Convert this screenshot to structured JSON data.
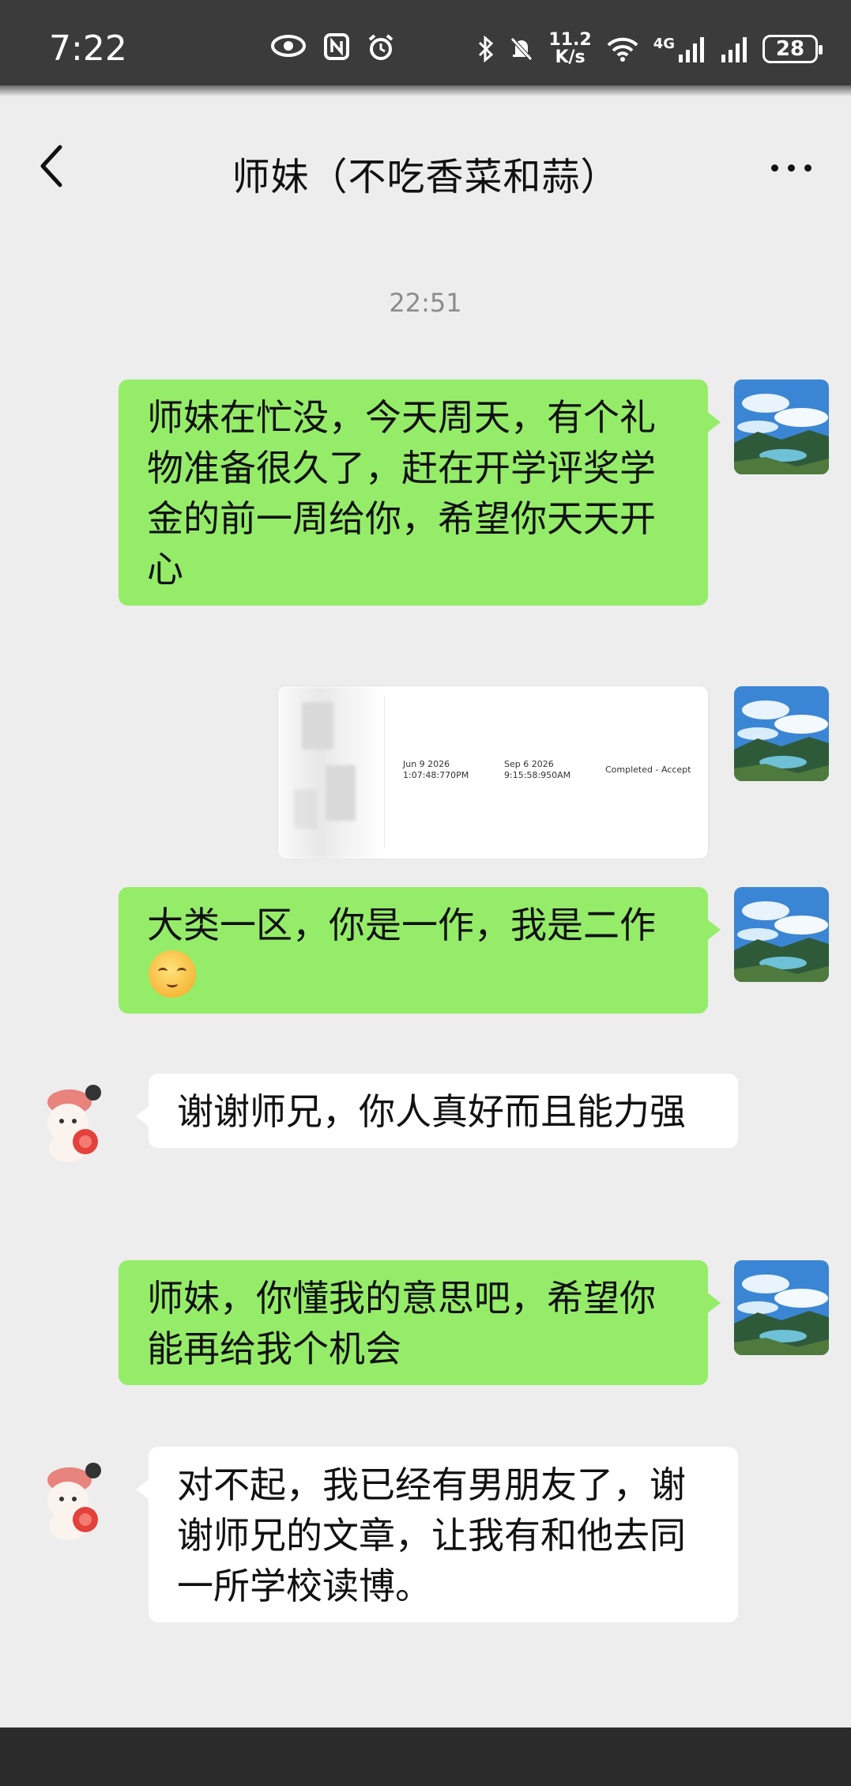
{
  "status_bar": {
    "time": "7:22",
    "net_speed_value": "11.2",
    "net_speed_unit": "K/s",
    "network_type": "4G",
    "battery": "28"
  },
  "header": {
    "title": "师妹（不吃香菜和蒜）"
  },
  "timestamp": "22:51",
  "messages": [
    {
      "side": "out",
      "text": "师妹在忙没，今天周天，有个礼物准备很久了，赶在开学评奖学金的前一周给你，希望你天天开心"
    },
    {
      "side": "out",
      "type": "image",
      "image": {
        "col1_line1": "Jun 9 2026",
        "col1_line2": "1:07:48:770PM",
        "col2_line1": "Sep 6 2026",
        "col2_line2": "9:15:58:950AM",
        "status": "Completed - Accept"
      }
    },
    {
      "side": "out",
      "text_before_emoji": "大类一区，你是一作，我是二作",
      "emoji": "shy-smile-emoji"
    },
    {
      "side": "in",
      "text": "谢谢师兄，你人真好而且能力强"
    },
    {
      "side": "out",
      "text": "师妹，你懂我的意思吧，希望你能再给我个机会"
    },
    {
      "side": "in",
      "text": "对不起，我已经有男朋友了，谢谢师兄的文章，让我有和他去同一所学校读博。"
    }
  ],
  "colors": {
    "outgoing_bubble": "#95ec69",
    "incoming_bubble": "#ffffff",
    "chat_background": "#ededed"
  }
}
